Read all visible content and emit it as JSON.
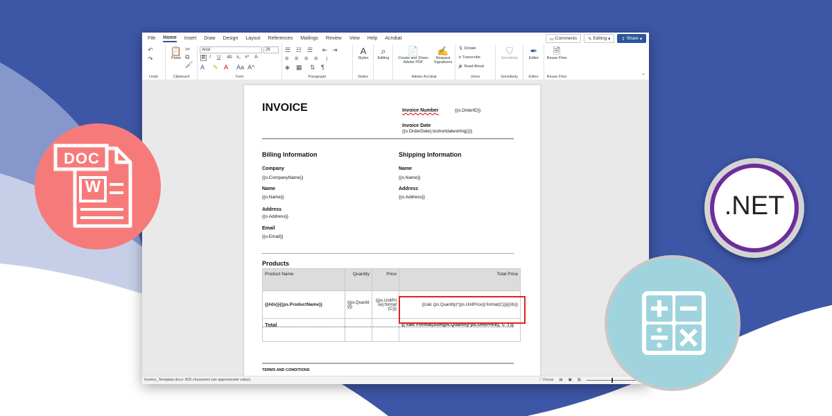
{
  "menu": {
    "items": [
      "File",
      "Home",
      "Insert",
      "Draw",
      "Design",
      "Layout",
      "References",
      "Mailings",
      "Review",
      "View",
      "Help",
      "Acrobat"
    ],
    "active": "Home",
    "comments_label": "Comments",
    "editing_label": "Editing",
    "share_label": "Share"
  },
  "ribbon": {
    "font_name": "Arial",
    "font_size": "26",
    "groups": {
      "undo": "Undo",
      "clipboard": "Clipboard",
      "font": "Font",
      "paragraph": "Paragraph",
      "styles": "Styles",
      "adobe": "Adobe Acrobat",
      "voice": "Voice",
      "sensitivity": "Sensitivity",
      "editor": "Editor",
      "reuse": "Reuse Files"
    },
    "buttons": {
      "paste": "Paste",
      "styles": "Styles",
      "editing": "Editing",
      "create_share": "Create and Share Adobe PDF",
      "request_sig": "Request Signatures",
      "dictate": "Dictate",
      "transcribe": "Transcribe",
      "read_aloud": "Read Aloud",
      "sensitivity": "Sensitivity",
      "editor": "Editor",
      "reuse_files": "Reuse Files"
    }
  },
  "document": {
    "title": "INVOICE",
    "invoice_number_label": "Invoice Number",
    "invoice_number_value": "{{o.OrderID}}",
    "invoice_date_label": "Invoice Date",
    "invoice_date_value": "{{o.OrderDate}.toshortdatestring()}}",
    "billing_title": "Billing Information",
    "shipping_title": "Shipping Information",
    "billing": [
      {
        "label": "Company",
        "value": "{{o.CompanyName}}"
      },
      {
        "label": "Name",
        "value": "{{o.Name}}"
      },
      {
        "label": "Address",
        "value": "{{o.Address}}"
      },
      {
        "label": "Email",
        "value": "{{o.Email}}"
      }
    ],
    "shipping": [
      {
        "label": "Name",
        "value": "{{o.Name}}"
      },
      {
        "label": "Address",
        "value": "{{o.Address}}"
      }
    ],
    "products_title": "Products",
    "table": {
      "headers": [
        "Product Name",
        "Quantity",
        "Price",
        "Total Price"
      ],
      "row": [
        "{{#ds}}{{ps.ProductName}}",
        "{{ps.Quantity}}",
        "{{ps.UnitPrice}:format(C)}}",
        "{{calc (ps.Quantity)*(ps.UnitPrice)}:format(C)}}{{/ds}}"
      ],
      "total_label": "Total",
      "total_formula": "{{ calc Format(Sum(ps.Quantity*ps.UnitPrice),\"C\") }}"
    },
    "terms": "TERMS AND CONDITIONS"
  },
  "status": {
    "left": "Invoice_Template.docx: 833 characters (an approximate value).",
    "focus": "Focus"
  },
  "badges": {
    "doc_text": "DOC",
    "word_letter": "W",
    "net_text": ".NET"
  },
  "colors": {
    "background_blue": "#3d56a6",
    "doc_badge": "#f77a7a",
    "net_purple": "#6e2c9a",
    "calc_badge": "#9fd4de",
    "word_blue": "#2b579a",
    "highlight_red": "#e02020"
  }
}
